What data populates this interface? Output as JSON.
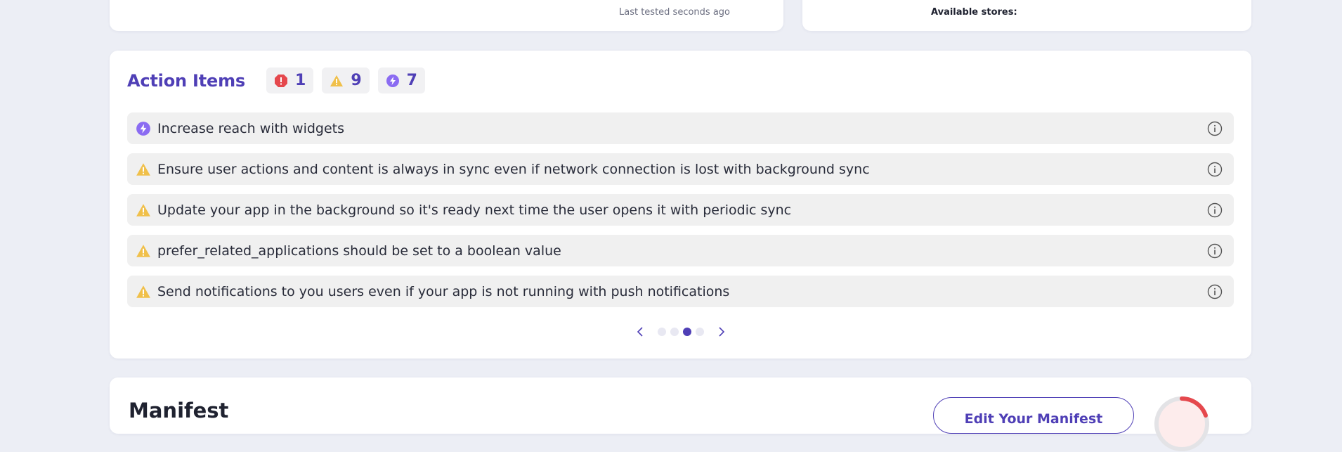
{
  "top_cards": {
    "last_tested": "Last tested seconds ago",
    "available_stores": "Available stores:"
  },
  "action_items": {
    "title": "Action Items",
    "badges": [
      {
        "type": "error",
        "count": "1",
        "icon": "error-icon",
        "color": "#e5484d"
      },
      {
        "type": "warning",
        "count": "9",
        "icon": "warning-icon",
        "color": "#f0c04a"
      },
      {
        "type": "enhancement",
        "count": "7",
        "icon": "lightning-icon",
        "color": "#8b6cf2"
      }
    ],
    "items": [
      {
        "icon": "lightning-icon",
        "text": "Increase reach with widgets"
      },
      {
        "icon": "warning-icon",
        "text": "Ensure user actions and content is always in sync even if network connection is lost with background sync"
      },
      {
        "icon": "warning-icon",
        "text": "Update your app in the background so it's ready next time the user opens it with periodic sync"
      },
      {
        "icon": "warning-icon",
        "text": "prefer_related_applications should be set to a boolean value"
      },
      {
        "icon": "warning-icon",
        "text": "Send notifications to you users even if your app is not running with push notifications"
      }
    ],
    "pager": {
      "pages": 4,
      "active_page": 3
    }
  },
  "manifest": {
    "title": "Manifest",
    "edit_button": "Edit Your Manifest"
  },
  "colors": {
    "accent": "#4f3fb6",
    "error": "#e5484d",
    "warning": "#f0c04a",
    "enhancement": "#8b6cf2"
  }
}
